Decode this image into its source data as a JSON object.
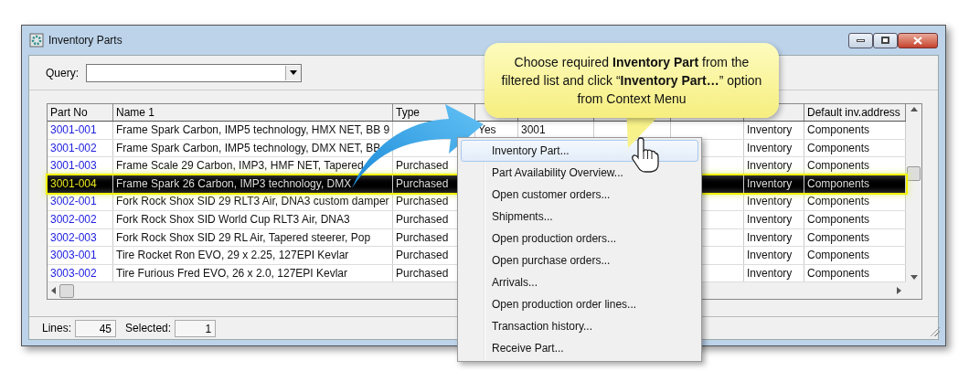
{
  "window": {
    "title": "Inventory Parts"
  },
  "query": {
    "label": "Query:"
  },
  "table": {
    "columns": [
      {
        "label": "Part No"
      },
      {
        "label": "Name 1"
      },
      {
        "label": "Type"
      },
      {},
      {},
      {},
      {},
      {},
      {
        "label": "Default inv.address"
      }
    ],
    "rows": [
      {
        "selected": false,
        "cells": [
          "3001-001",
          "Frame Spark Carbon, IMP5 technology, HMX NET, BB 9",
          null,
          "Yes",
          "3001",
          null,
          null,
          "Inventory",
          "Components"
        ]
      },
      {
        "selected": false,
        "cells": [
          "3001-002",
          "Frame Spark Carbon, IMP5 technology, DMX NET, BB",
          null,
          null,
          null,
          null,
          null,
          "Inventory",
          "Components"
        ]
      },
      {
        "selected": false,
        "cells": [
          "3001-003",
          "Frame Scale 29 Carbon, IMP3, HMF NET, Tapered",
          "Purchased",
          null,
          null,
          null,
          null,
          "Inventory",
          "Components"
        ]
      },
      {
        "selected": true,
        "cells": [
          "3001-004",
          "Frame Spark 26 Carbon, IMP3 technology, DMX",
          "Purchased",
          null,
          null,
          null,
          null,
          "Inventory",
          "Components"
        ]
      },
      {
        "selected": false,
        "cells": [
          "3002-001",
          "Fork Rock Shox SID 29 RLT3 Air, DNA3 custom damper",
          "Purchased",
          null,
          null,
          null,
          null,
          "Inventory",
          "Components"
        ]
      },
      {
        "selected": false,
        "cells": [
          "3002-002",
          "Fork Rock Shox SID World Cup RLT3 Air, DNA3",
          "Purchased",
          null,
          null,
          null,
          null,
          "Inventory",
          "Components"
        ]
      },
      {
        "selected": false,
        "cells": [
          "3002-003",
          "Fork Rock Shox SID 29 RL Air, Tapered steerer, Pop",
          "Purchased",
          null,
          null,
          null,
          null,
          "Inventory",
          "Components"
        ]
      },
      {
        "selected": false,
        "cells": [
          "3003-001",
          "Tire Rocket Ron EVO, 29 x 2.25, 127EPI Kevlar",
          "Purchased",
          null,
          null,
          null,
          null,
          "Inventory",
          "Components"
        ]
      },
      {
        "selected": false,
        "cells": [
          "3003-002",
          "Tire Furious Fred EVO, 26 x 2.0, 127EPI Kevlar",
          "Purchased",
          null,
          null,
          null,
          null,
          "Inventory",
          "Components"
        ]
      }
    ]
  },
  "status_bar": [
    {
      "label": "Lines:",
      "value": "45"
    },
    {
      "label": "Selected:",
      "value": "1"
    }
  ],
  "callout": {
    "text": "Choose required **Inventory Part** from the filtered list and click “**Inventory Part…**” option from Context Menu"
  },
  "context_menu": [
    {
      "label": "Inventory Part...",
      "selected": true
    },
    {
      "label": "Part Availability Overview...",
      "selected": false
    },
    {
      "label": "Open customer orders...",
      "selected": false
    },
    {
      "label": "Shipments...",
      "selected": false
    },
    {
      "label": "Open production orders...",
      "selected": false
    },
    {
      "label": "Open purchase orders...",
      "selected": false
    },
    {
      "label": "Arrivals...",
      "selected": false
    },
    {
      "label": "Open production order lines...",
      "selected": false
    },
    {
      "label": "Transaction history...",
      "selected": false
    },
    {
      "label": "Receive Part...",
      "selected": false
    }
  ]
}
